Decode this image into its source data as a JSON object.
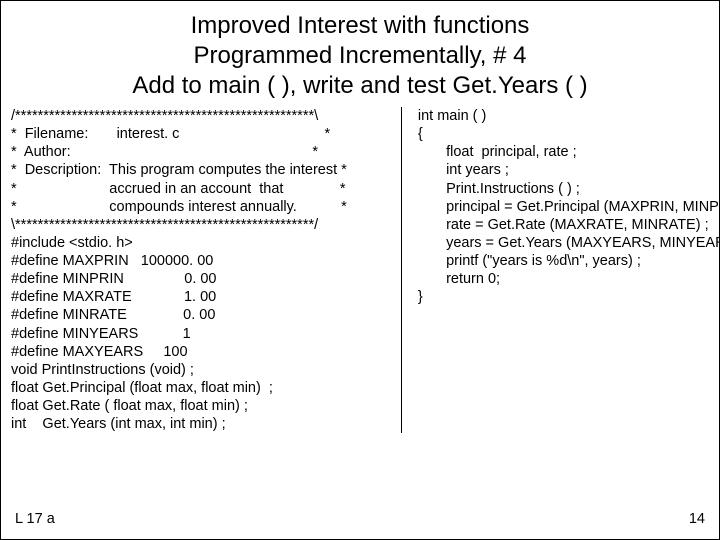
{
  "title": {
    "line1": "Improved Interest  with functions",
    "line2": "Programmed Incrementally, # 4",
    "line3": "Add to main ( ), write and test Get.Years ( )"
  },
  "left_code": "/*****************************************************\\\n*  Filename:       interest. c                                    *\n*  Author:                                                            *\n*  Description:  This program computes the interest *\n*                       accrued in an account  that              *\n*                       compounds interest annually.           *\n\\*****************************************************/\n#include <stdio. h>\n#define MAXPRIN   100000. 00\n#define MINPRIN               0. 00\n#define MAXRATE             1. 00\n#define MINRATE              0. 00\n#define MINYEARS           1\n#define MAXYEARS     100\nvoid PrintInstructions (void) ;\nfloat Get.Principal (float max, float min)  ;\nfloat Get.Rate ( float max, float min) ;\nint    Get.Years (int max, int min) ;",
  "right_code": "int main ( )\n{\n       float  principal, rate ;\n       int years ;\n       Print.Instructions ( ) ;\n       principal = Get.Principal (MAXPRIN, MINPRIN) ;\n       rate = Get.Rate (MAXRATE, MINRATE) ;\n       years = Get.Years (MAXYEARS, MINYEARS) ;\n       printf (\"years is %d\\n\", years) ;\n       return 0;\n}",
  "footer": {
    "left": "L 17 a",
    "right": "14"
  }
}
